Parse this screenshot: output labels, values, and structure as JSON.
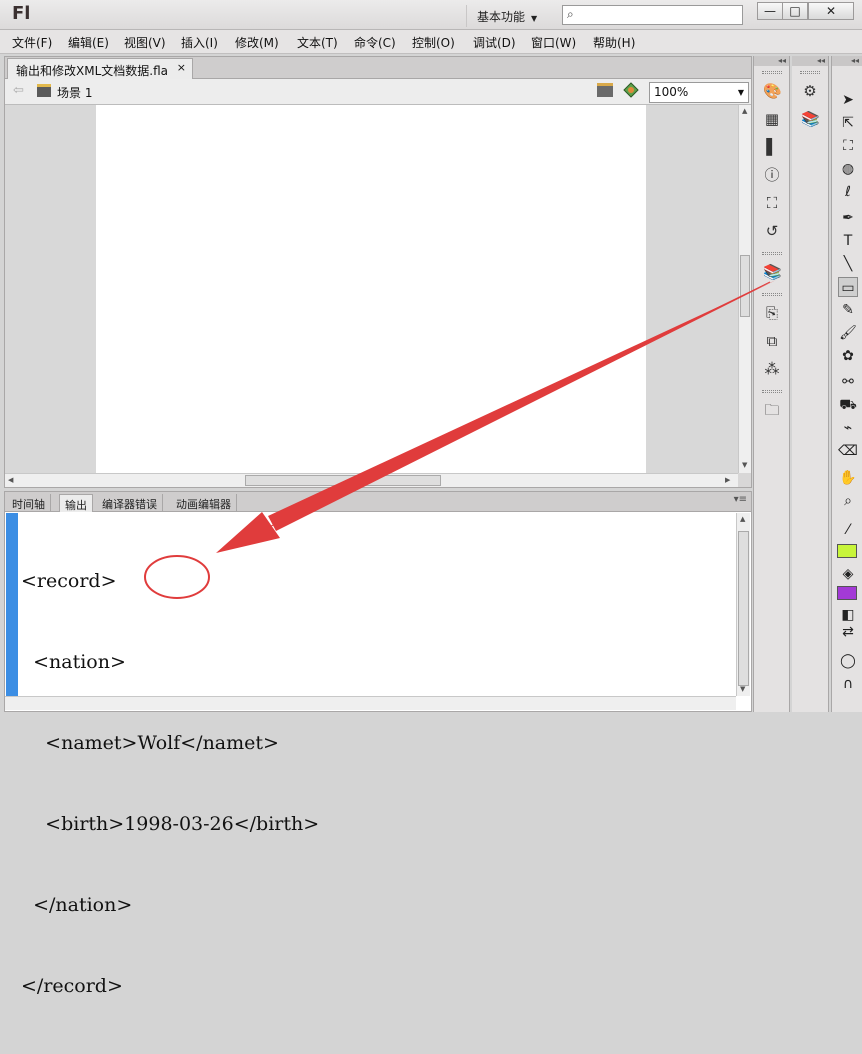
{
  "app": {
    "logo": "Fl",
    "workspace": "基本功能"
  },
  "window_controls": {
    "minimize": "—",
    "maximize": "□",
    "close": "✕"
  },
  "menu": [
    "文件(F)",
    "编辑(E)",
    "视图(V)",
    "插入(I)",
    "修改(M)",
    "文本(T)",
    "命令(C)",
    "控制(O)",
    "调试(D)",
    "窗口(W)",
    "帮助(H)"
  ],
  "document": {
    "tab_title": "输出和修改XML文档数据.fla",
    "close": "×",
    "scene": "场景 1",
    "zoom": "100%"
  },
  "output_panel": {
    "tabs": [
      "时间轴",
      "输出",
      "编译器错误",
      "动画编辑器"
    ],
    "active_tab": "输出",
    "lines": [
      "<record>",
      "  <nation>",
      "    <namet>Wolf</namet>",
      "    <birth>1998-03-26</birth>",
      "  </nation>",
      "</record>"
    ]
  },
  "colors": {
    "annotation_red": "#e03c3c",
    "output_margin": "#3c8ee4",
    "stroke_swatch": "#c8f53a",
    "fill_swatch": "#a33ad6"
  },
  "icons": {
    "right_panel_1": [
      "color-palette-icon",
      "swatches-grid-icon",
      "align-icon",
      "info-icon",
      "transform-icon",
      "motion-presets-icon",
      "library-icon",
      "actions-icon",
      "components-icon",
      "behaviors-icon",
      "project-icon"
    ],
    "right_panel_2": [
      "properties-icon",
      "library-icon"
    ],
    "tools": [
      "selection-tool-icon",
      "subselection-tool-icon",
      "free-transform-tool-icon",
      "3d-rotation-tool-icon",
      "lasso-tool-icon",
      "pen-tool-icon",
      "text-tool-icon",
      "line-tool-icon",
      "rectangle-tool-icon",
      "pencil-tool-icon",
      "brush-tool-icon",
      "deco-tool-icon",
      "bone-tool-icon",
      "paint-bucket-tool-icon",
      "eyedropper-tool-icon",
      "eraser-tool-icon",
      "hand-tool-icon",
      "zoom-tool-icon",
      "stroke-color-icon",
      "fill-color-icon",
      "black-white-icon",
      "swap-colors-icon",
      "snap-icon",
      "magnet-icon"
    ]
  }
}
